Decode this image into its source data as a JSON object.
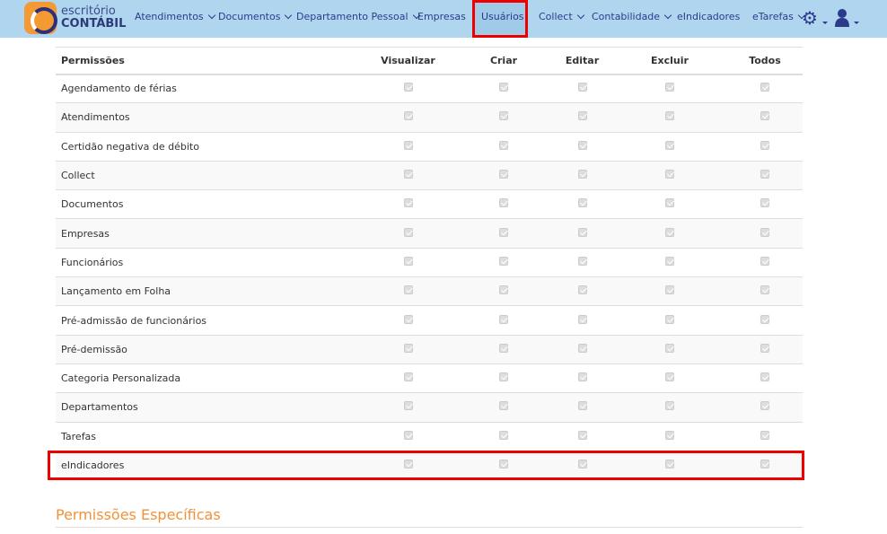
{
  "header": {
    "logo_line1": "escritório",
    "logo_line2": "CONTÁBIL",
    "nav": [
      {
        "label": "Atendimentos",
        "dropdown": true
      },
      {
        "label": "Documentos",
        "dropdown": true
      },
      {
        "label": "Departamento Pessoal",
        "dropdown": true
      },
      {
        "label": "Empresas",
        "dropdown": false
      },
      {
        "label": "Usuários",
        "dropdown": false,
        "active": true
      },
      {
        "label": "Collect",
        "dropdown": true
      },
      {
        "label": "Contabilidade",
        "dropdown": true
      },
      {
        "label": "eIndicadores",
        "dropdown": false
      },
      {
        "label": "eTarefas",
        "dropdown": true
      }
    ]
  },
  "table": {
    "columns": [
      "Permissões",
      "Visualizar",
      "Criar",
      "Editar",
      "Excluir",
      "Todos"
    ],
    "rows": [
      "Agendamento de férias",
      "Atendimentos",
      "Certidão negativa de débito",
      "Collect",
      "Documentos",
      "Empresas",
      "Funcionários",
      "Lançamento em Folha",
      "Pré-admissão de funcionários",
      "Pré-demissão",
      "Categoria Personalizada",
      "Departamentos",
      "Tarefas",
      "eIndicadores"
    ],
    "all_checked": true,
    "disabled": true
  },
  "section_title": "Permissões Específicas",
  "colors": {
    "nav_bg": "#b0d6ef",
    "accent": "#f0923a",
    "highlight": "#ee0000"
  }
}
